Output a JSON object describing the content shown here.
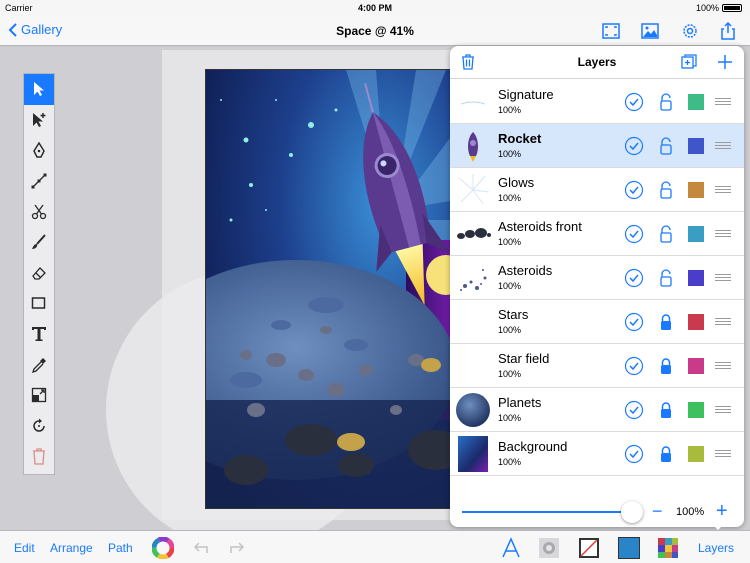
{
  "status": {
    "carrier": "Carrier",
    "time": "4:00 PM",
    "battery": "100%"
  },
  "nav": {
    "back_label": "Gallery",
    "title": "Space @ 41%"
  },
  "toolbox": {
    "tools": [
      "select-arrow-icon",
      "direct-select-icon",
      "pen-icon",
      "node-icon",
      "scissors-icon",
      "brush-icon",
      "eraser-icon",
      "rectangle-icon",
      "text-icon",
      "eyedropper-icon",
      "transform-icon",
      "rotate-icon",
      "trash-icon"
    ],
    "selected": 0
  },
  "layers": {
    "title": "Layers",
    "items": [
      {
        "name": "Signature",
        "opacity": "100%",
        "color": "#3dbc88",
        "locked": false
      },
      {
        "name": "Rocket",
        "opacity": "100%",
        "color": "#3e56c9",
        "locked": false
      },
      {
        "name": "Glows",
        "opacity": "100%",
        "color": "#c4893c",
        "locked": false
      },
      {
        "name": "Asteroids front",
        "opacity": "100%",
        "color": "#3a9dc3",
        "locked": false
      },
      {
        "name": "Asteroids",
        "opacity": "100%",
        "color": "#4a3dc9",
        "locked": false
      },
      {
        "name": "Stars",
        "opacity": "100%",
        "color": "#c93a4e",
        "locked": true
      },
      {
        "name": "Star field",
        "opacity": "100%",
        "color": "#c93a8a",
        "locked": true
      },
      {
        "name": "Planets",
        "opacity": "100%",
        "color": "#3fc05e",
        "locked": true
      },
      {
        "name": "Background",
        "opacity": "100%",
        "color": "#a8bb3d",
        "locked": true
      }
    ],
    "selected_index": 1,
    "opacity_label": "100%",
    "opacity_fraction": 1.0
  },
  "bottom": {
    "edit": "Edit",
    "arrange": "Arrange",
    "path": "Path",
    "layers": "Layers"
  },
  "colors": {
    "accent": "#1a7aff",
    "fill_swatch": "#2a84c8"
  }
}
